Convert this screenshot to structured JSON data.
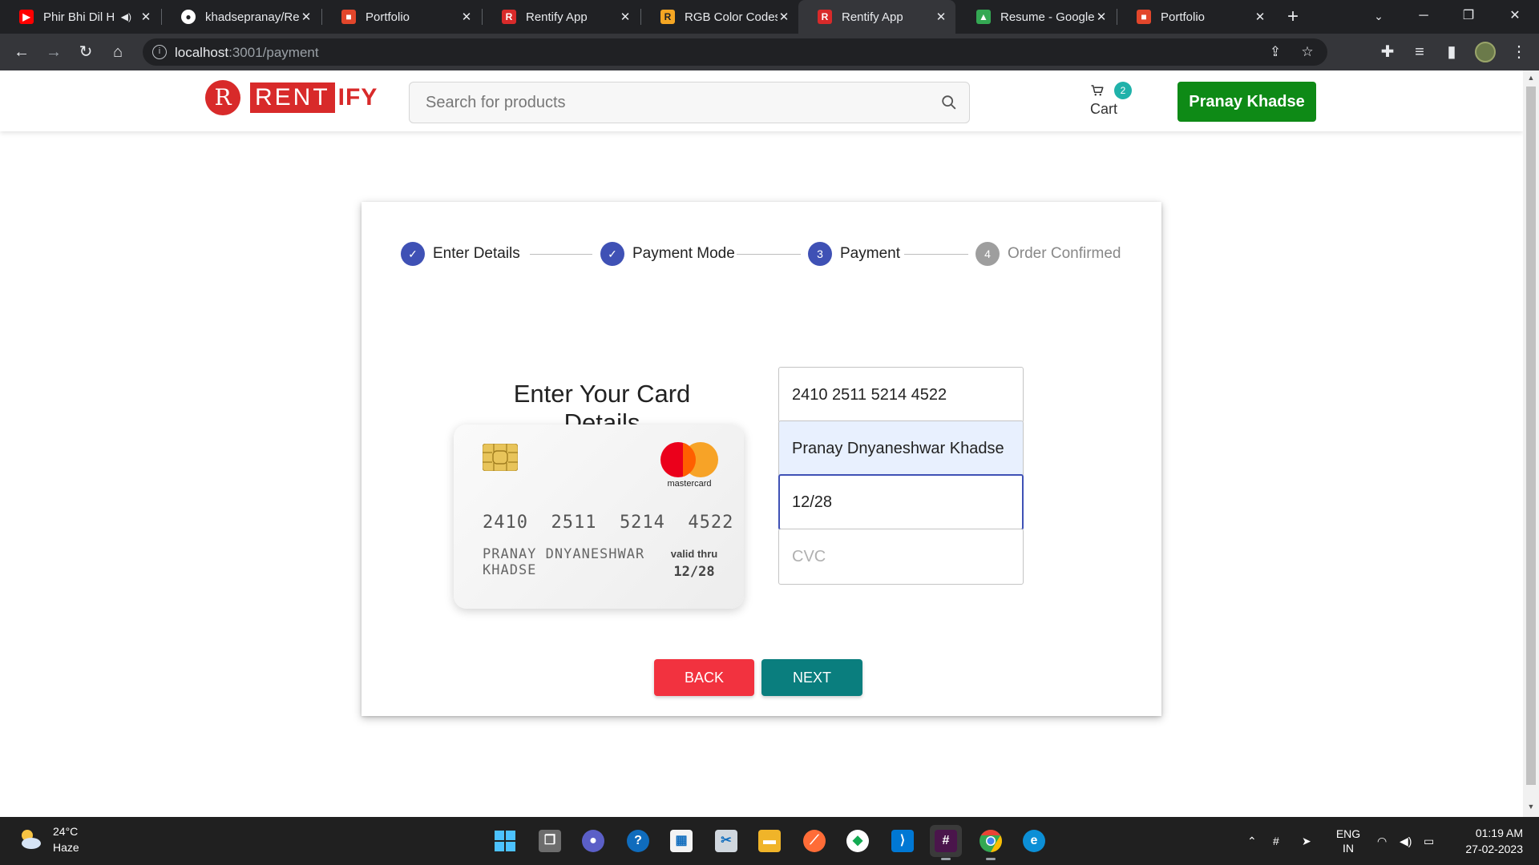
{
  "browser": {
    "tabs": [
      {
        "title": "Phir Bhi Dil H",
        "icon": "youtube-icon",
        "color": "#ff0000",
        "audio": true
      },
      {
        "title": "khadsepranay/Re",
        "icon": "github-icon",
        "color": "#ffffff"
      },
      {
        "title": "Portfolio",
        "icon": "portfolio-icon",
        "color": "#e2462b"
      },
      {
        "title": "Rentify App",
        "icon": "rentify-icon",
        "color": "#d82a2a"
      },
      {
        "title": "RGB Color Codes",
        "icon": "rgb-icon",
        "color": "#f5a623"
      },
      {
        "title": "Rentify App",
        "icon": "rentify-icon",
        "color": "#d82a2a",
        "active": true
      },
      {
        "title": "Resume - Google",
        "icon": "google-drive-icon",
        "color": "#34a853"
      },
      {
        "title": "Portfolio",
        "icon": "portfolio-icon",
        "color": "#e2462b"
      }
    ],
    "url_host": "localhost",
    "url_path": ":3001/payment"
  },
  "navbar": {
    "logo_rent": "RENT",
    "logo_ify": "IFY",
    "search_placeholder": "Search for products",
    "cart_count": "2",
    "cart_label": "Cart",
    "user_name": "Pranay Khadse"
  },
  "stepper": {
    "steps": [
      {
        "label": "Enter Details",
        "state": "done",
        "marker": "✓"
      },
      {
        "label": "Payment Mode",
        "state": "done",
        "marker": "✓"
      },
      {
        "label": "Payment",
        "state": "active",
        "marker": "3"
      },
      {
        "label": "Order Confirmed",
        "state": "pending",
        "marker": "4"
      }
    ]
  },
  "payment": {
    "heading": "Enter Your Card Details",
    "card": {
      "number": "2410  2511  5214  4522",
      "name": "PRANAY DNYANESHWAR KHADSE",
      "valid_label": "valid thru",
      "expiry": "12/28",
      "brand": "mastercard"
    },
    "fields": {
      "number_value": "2410 2511 5214 4522",
      "name_value": "Pranay Dnyaneshwar Khadse",
      "expiry_value": "12/28",
      "cvc_placeholder": "CVC"
    },
    "back_label": "BACK",
    "next_label": "NEXT",
    "colors": {
      "primary": "#3f51b5",
      "back": "#f2323f",
      "next": "#0a7e7e",
      "user_button": "#0e8a16"
    }
  },
  "taskbar": {
    "temperature": "24°C",
    "weather": "Haze",
    "lang_top": "ENG",
    "lang_bottom": "IN",
    "time": "01:19 AM",
    "date": "27-02-2023"
  }
}
